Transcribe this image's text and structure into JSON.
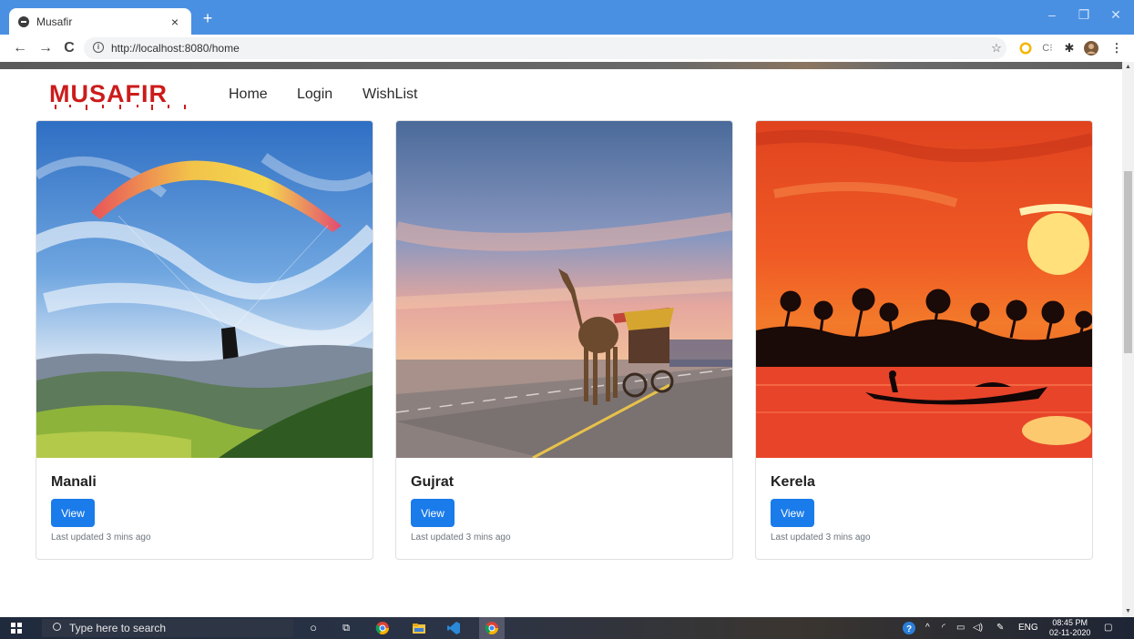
{
  "browser": {
    "tab_title": "Musafir",
    "tab_close": "×",
    "new_tab": "+",
    "url": "http://localhost:8080/home",
    "controls": {
      "minimize": "–",
      "maximize": "❐",
      "close": "✕"
    },
    "nav": {
      "back": "←",
      "forward": "→",
      "reload": "C"
    }
  },
  "site": {
    "logo": "MUSAFIR",
    "nav_links": [
      "Home",
      "Login",
      "WishList"
    ]
  },
  "cards": [
    {
      "title": "Manali",
      "button": "View",
      "meta": "Last updated 3 mins ago",
      "image": "paragliding-over-mountains"
    },
    {
      "title": "Gujrat",
      "button": "View",
      "meta": "Last updated 3 mins ago",
      "image": "camel-cart-on-desert-road"
    },
    {
      "title": "Kerela",
      "button": "View",
      "meta": "Last updated 3 mins ago",
      "image": "sunset-boat-backwaters"
    }
  ],
  "taskbar": {
    "search_placeholder": "Type here to search",
    "language": "ENG",
    "time": "08:45 PM",
    "date": "02-11-2020"
  },
  "colors": {
    "browser_accent": "#4a90e2",
    "logo_red": "#cc1b1b",
    "button_blue": "#1a7bea"
  }
}
